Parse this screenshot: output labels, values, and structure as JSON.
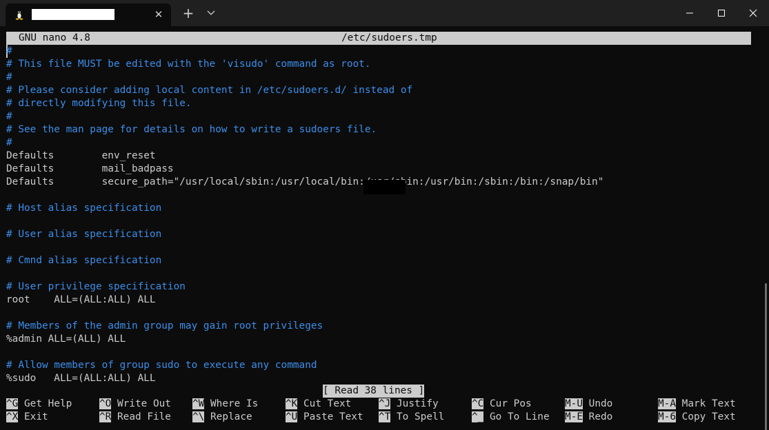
{
  "window": {
    "tab_close_glyph": "✕",
    "new_tab_glyph": "+",
    "colors": {
      "titlebar": "#202020",
      "terminal_bg": "#0c0c0c",
      "text": "#cccccc",
      "comment": "#3b8eea"
    }
  },
  "header": {
    "app": "GNU nano 4.8",
    "filename": "/etc/sudoers.tmp"
  },
  "file_lines": [
    {
      "text": "#",
      "type": "comment"
    },
    {
      "text": "# This file MUST be edited with the 'visudo' command as root.",
      "type": "comment"
    },
    {
      "text": "#",
      "type": "comment"
    },
    {
      "text": "# Please consider adding local content in /etc/sudoers.d/ instead of",
      "type": "comment"
    },
    {
      "text": "# directly modifying this file.",
      "type": "comment"
    },
    {
      "text": "#",
      "type": "comment"
    },
    {
      "text": "# See the man page for details on how to write a sudoers file.",
      "type": "comment"
    },
    {
      "text": "#",
      "type": "comment"
    },
    {
      "text": "Defaults        env_reset",
      "type": "plain"
    },
    {
      "text": "Defaults        mail_badpass",
      "type": "plain"
    },
    {
      "text": "Defaults        secure_path=\"/usr/local/sbin:/usr/local/bin:/usr/sbin:/usr/bin:/sbin:/bin:/snap/bin\"",
      "type": "plain"
    },
    {
      "text": "",
      "type": "plain"
    },
    {
      "text": "# Host alias specification",
      "type": "comment"
    },
    {
      "text": "",
      "type": "plain"
    },
    {
      "text": "# User alias specification",
      "type": "comment"
    },
    {
      "text": "",
      "type": "plain"
    },
    {
      "text": "# Cmnd alias specification",
      "type": "comment"
    },
    {
      "text": "",
      "type": "plain"
    },
    {
      "text": "# User privilege specification",
      "type": "comment"
    },
    {
      "text": "root    ALL=(ALL:ALL) ALL",
      "type": "plain"
    },
    {
      "text": "",
      "type": "plain"
    },
    {
      "text": "# Members of the admin group may gain root privileges",
      "type": "comment"
    },
    {
      "text": "%admin ALL=(ALL) ALL",
      "type": "plain"
    },
    {
      "text": "",
      "type": "plain"
    },
    {
      "text": "# Allow members of group sudo to execute any command",
      "type": "comment"
    },
    {
      "text": "%sudo   ALL=(ALL:ALL) ALL",
      "type": "plain"
    }
  ],
  "status": "[ Read 38 lines ]",
  "shortcuts": [
    {
      "key": "^G",
      "label": "Get Help"
    },
    {
      "key": "^O",
      "label": "Write Out"
    },
    {
      "key": "^W",
      "label": "Where Is"
    },
    {
      "key": "^K",
      "label": "Cut Text"
    },
    {
      "key": "^J",
      "label": "Justify"
    },
    {
      "key": "^C",
      "label": "Cur Pos"
    },
    {
      "key": "M-U",
      "label": "Undo"
    },
    {
      "key": "M-A",
      "label": "Mark Text"
    },
    {
      "key": "^X",
      "label": "Exit"
    },
    {
      "key": "^R",
      "label": "Read File"
    },
    {
      "key": "^\\",
      "label": "Replace"
    },
    {
      "key": "^U",
      "label": "Paste Text"
    },
    {
      "key": "^T",
      "label": "To Spell"
    },
    {
      "key": "^_",
      "label": "Go To Line"
    },
    {
      "key": "M-E",
      "label": "Redo"
    },
    {
      "key": "M-6",
      "label": "Copy Text"
    }
  ]
}
